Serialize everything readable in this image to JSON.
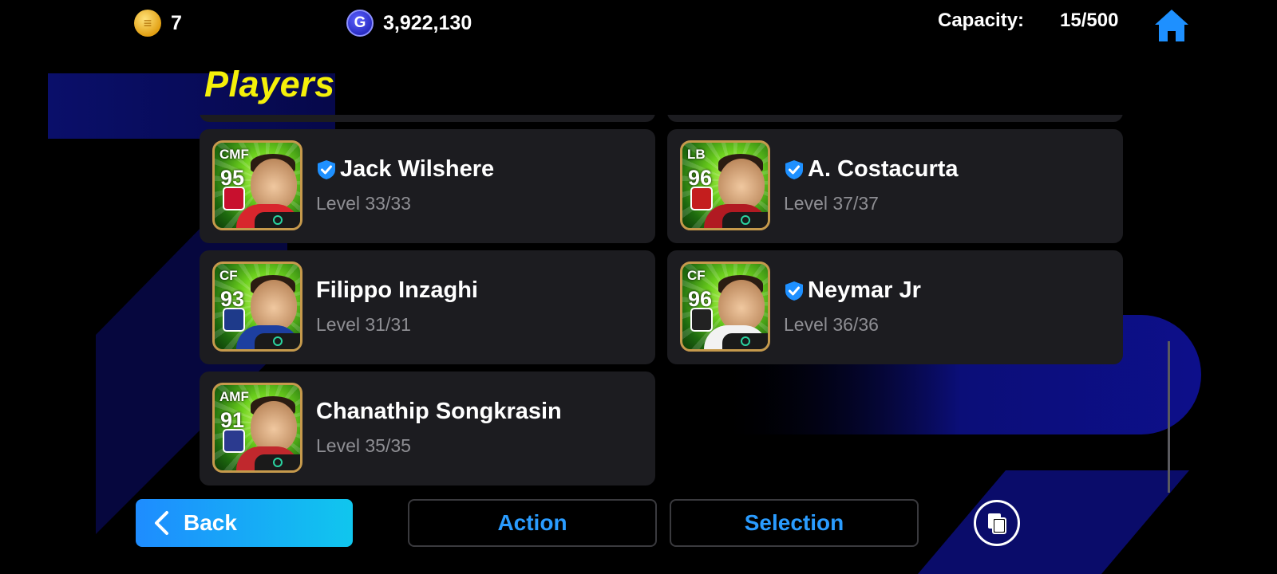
{
  "header": {
    "coins": {
      "icon": "efootball-coin-icon",
      "value": "7"
    },
    "gp": {
      "icon": "gp-coin-icon",
      "symbol": "G",
      "value": "3,922,130"
    },
    "capacity_label": "Capacity:",
    "capacity_value": "15/500",
    "home_icon": "home-icon"
  },
  "page_title": "Players",
  "players": [
    {
      "position": "",
      "rating": "",
      "name": "",
      "level": "",
      "verified": false,
      "partial": true
    },
    {
      "position": "",
      "rating": "",
      "name": "",
      "level": "",
      "verified": false,
      "partial": true
    },
    {
      "position": "CMF",
      "rating": "95",
      "name": "Jack Wilshere",
      "level": "Level 33/33",
      "verified": true,
      "shirt_color": "#d8262d",
      "badge_color": "#c8102e"
    },
    {
      "position": "LB",
      "rating": "96",
      "name": "A. Costacurta",
      "level": "Level 37/37",
      "verified": true,
      "shirt_color": "#b11a22",
      "badge_color": "#c41e1e"
    },
    {
      "position": "CF",
      "rating": "93",
      "name": "Filippo Inzaghi",
      "level": "Level 31/31",
      "verified": false,
      "shirt_color": "#1d3fa0",
      "badge_color": "#1e3a8a"
    },
    {
      "position": "CF",
      "rating": "96",
      "name": "Neymar Jr",
      "level": "Level 36/36",
      "verified": true,
      "shirt_color": "#f2f2f2",
      "badge_color": "#222222"
    },
    {
      "position": "AMF",
      "rating": "91",
      "name": "Chanathip Songkrasin",
      "level": "Level 35/35",
      "verified": false,
      "shirt_color": "#c0282d",
      "badge_color": "#2b3a8f"
    }
  ],
  "footer": {
    "back_label": "Back",
    "action_label": "Action",
    "selection_label": "Selection",
    "copy_icon": "copy-icon"
  },
  "colors": {
    "accent_blue": "#2a9cff",
    "title_yellow": "#f4f00a",
    "card_bg": "#1c1c20",
    "level_gray": "#8e8e93"
  }
}
